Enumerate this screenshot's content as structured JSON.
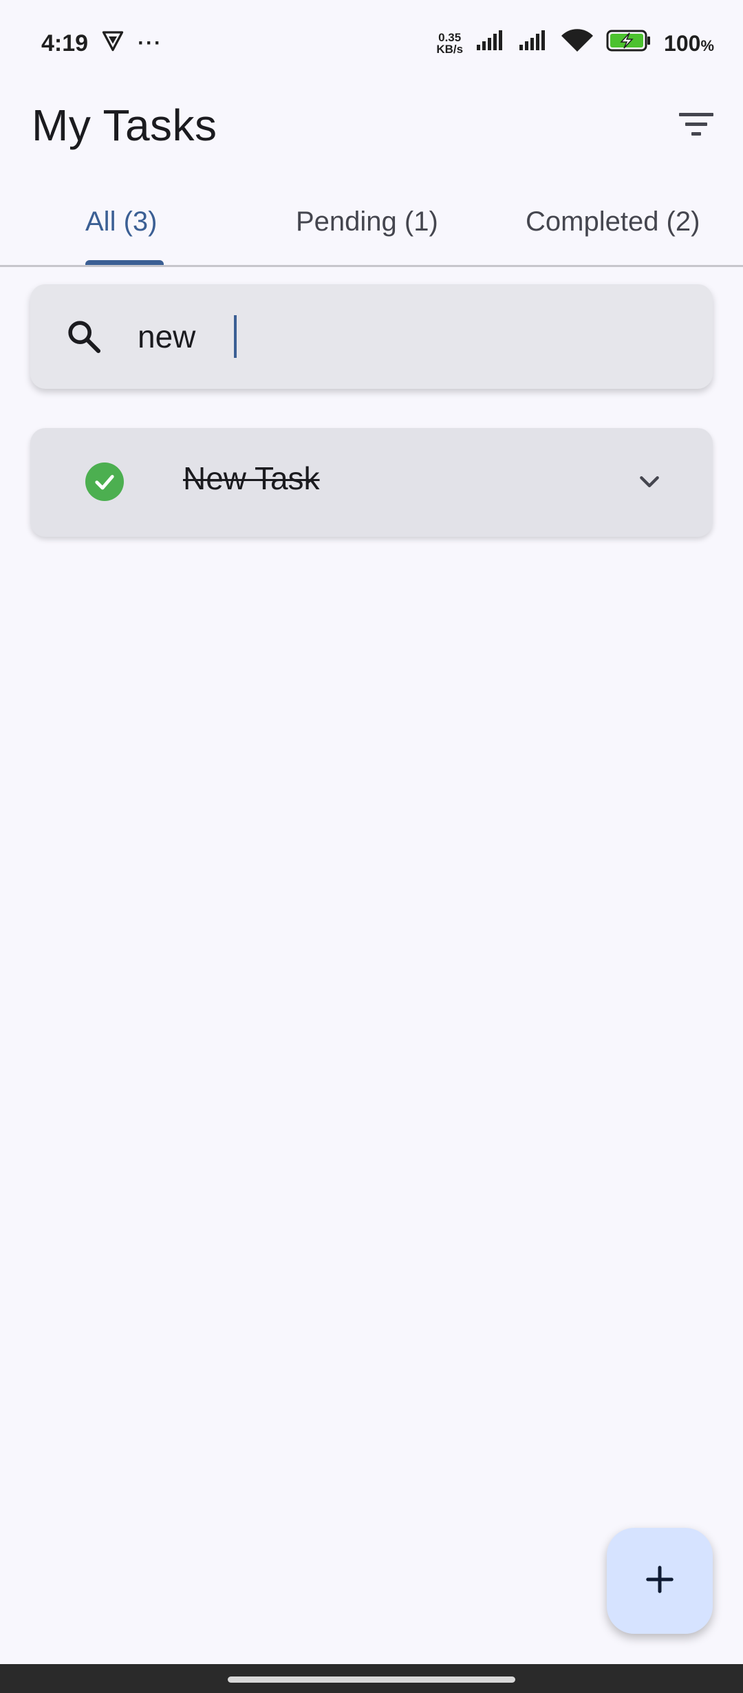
{
  "status_bar": {
    "time": "4:19",
    "more": "···",
    "net_speed_value": "0.35",
    "net_speed_unit": "KB/s",
    "battery_percent": "100",
    "battery_unit": "%"
  },
  "app_bar": {
    "title": "My Tasks"
  },
  "tabs": [
    {
      "label": "All (3)",
      "active": true
    },
    {
      "label": "Pending (1)",
      "active": false
    },
    {
      "label": "Completed (2)",
      "active": false
    }
  ],
  "search": {
    "value": "new",
    "placeholder": ""
  },
  "tasks": [
    {
      "title": "New Task",
      "completed": true
    }
  ],
  "colors": {
    "accent": "#3b5f94",
    "check_green": "#4caf50",
    "fab_background": "#d6e3ff",
    "background": "#f8f7fd"
  },
  "icons": {
    "filter": "filter-icon",
    "search": "search-icon",
    "check": "check-circle-icon",
    "expand": "chevron-down-icon",
    "add": "plus-icon"
  }
}
